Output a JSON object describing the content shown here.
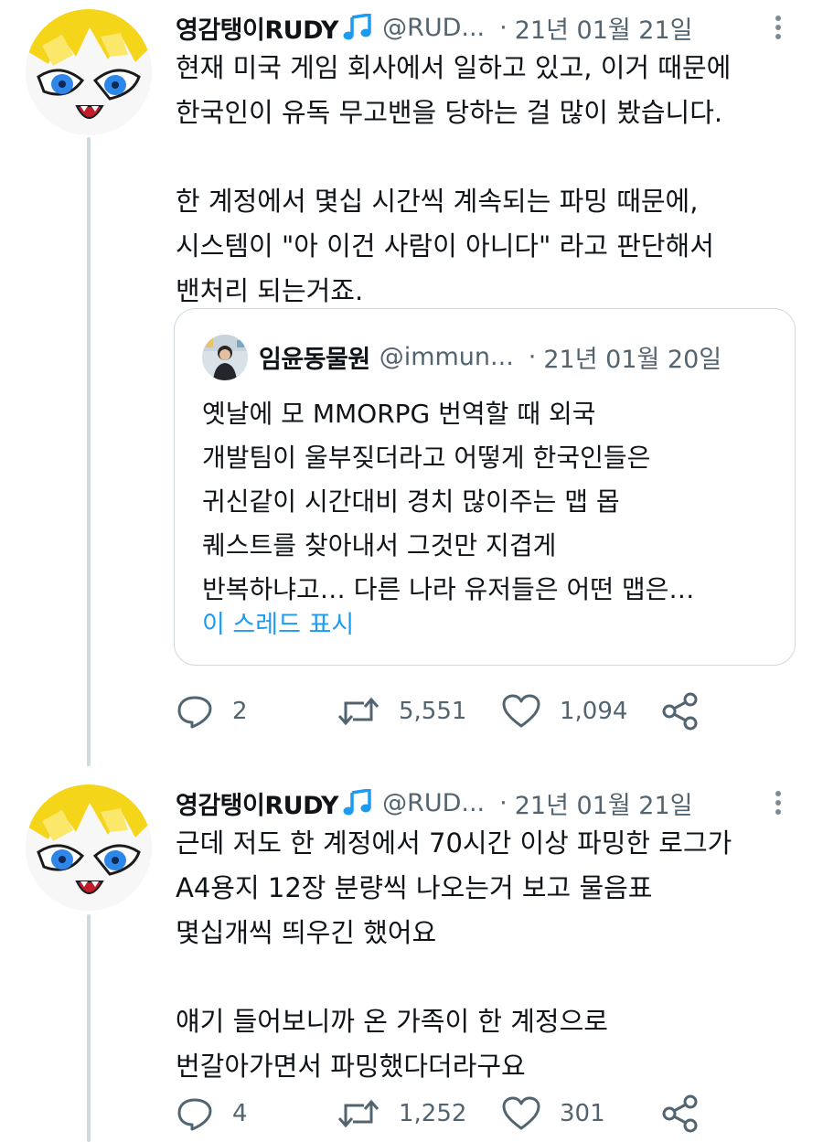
{
  "tweets": [
    {
      "author": {
        "name": "영감탱이RUDY",
        "badge": "music-note-icon",
        "handle": "@RUD...",
        "date": "21년 01월 21일"
      },
      "paragraphs": [
        [
          "현재 미국 게임 회사에서 일하고 있고, 이거 때문에",
          "한국인이 유독 무고밴을 당하는 걸 많이 봤습니다."
        ],
        [
          "한 계정에서 몇십 시간씩 계속되는 파밍 때문에,",
          "시스템이 \"아 이건 사람이 아니다\" 라고 판단해서",
          "밴처리 되는거죠."
        ]
      ],
      "quote": {
        "author": {
          "name": "임윤동물원",
          "handle": "@immun...",
          "date": "21년 01월 20일"
        },
        "lines": [
          "옛날에 모 MMORPG 번역할 때 외국",
          "개발팀이 울부짖더라고 어떻게 한국인들은",
          "귀신같이 시간대비 경치 많이주는 맵 몹",
          "퀘스트를 찾아내서 그것만 지겹게",
          "반복하냐고… 다른 나라 유저들은 어떤 맵은…"
        ],
        "show_thread": "이 스레드 표시"
      },
      "actions": {
        "replies": "2",
        "retweets": "5,551",
        "likes": "1,094"
      }
    },
    {
      "author": {
        "name": "영감탱이RUDY",
        "badge": "music-note-icon",
        "handle": "@RUD...",
        "date": "21년 01월 21일"
      },
      "paragraphs": [
        [
          "근데 저도 한 계정에서 70시간 이상 파밍한 로그가",
          "A4용지 12장 분량씩 나오는거 보고 물음표",
          "몇십개씩 띄우긴 했어요"
        ],
        [
          "얘기 들어보니까 온 가족이 한 계정으로",
          "번갈아가면서 파밍했다더라구요"
        ]
      ],
      "actions": {
        "replies": "4",
        "retweets": "1,252",
        "likes": "301"
      }
    }
  ],
  "colors": {
    "accent": "#1d9bf0",
    "text": "#0f1419",
    "secondary": "#536471",
    "border": "#cfd9de",
    "avatar_yellow": "#f5d51a",
    "avatar_eye": "#2e87e8"
  }
}
